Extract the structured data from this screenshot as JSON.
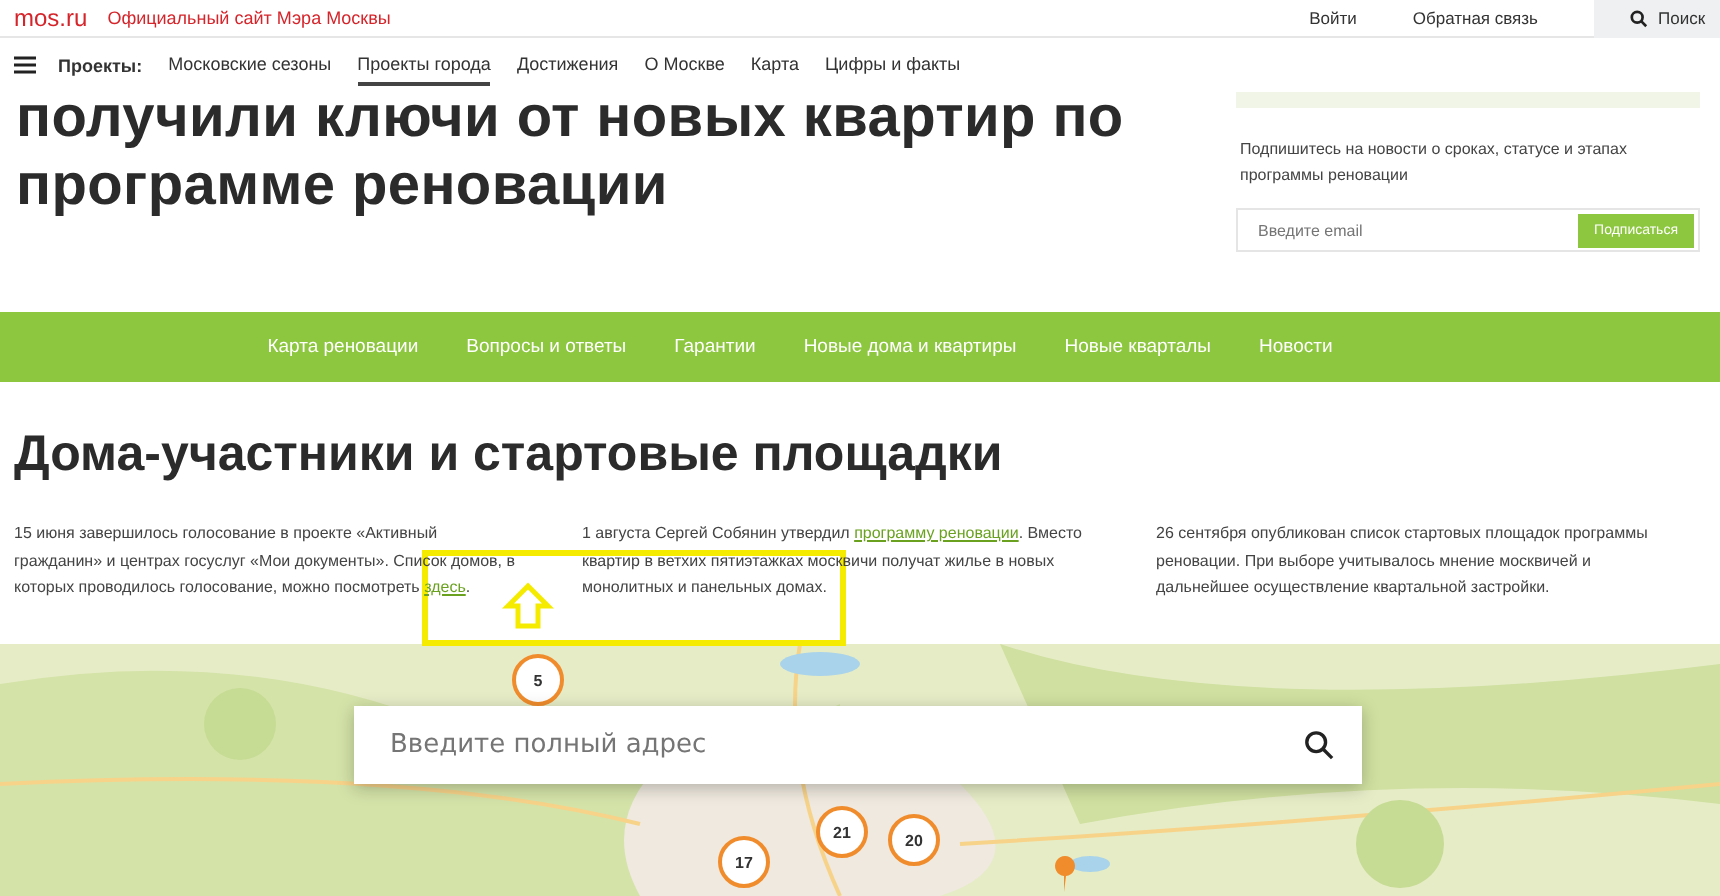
{
  "topbar": {
    "logo": "mos.ru",
    "site_title": "Официальный сайт Мэра Москвы",
    "links": [
      "Войти",
      "Обратная связь"
    ],
    "search": "Поиск"
  },
  "nav": {
    "label": "Проекты:",
    "items": [
      {
        "label": "Московские сезоны",
        "selected": false
      },
      {
        "label": "Проекты города",
        "selected": true
      },
      {
        "label": "Достижения",
        "selected": false
      },
      {
        "label": "О Москве",
        "selected": false
      },
      {
        "label": "Карта",
        "selected": false
      },
      {
        "label": "Цифры и факты",
        "selected": false
      }
    ]
  },
  "hero": {
    "title": "получили ключи от новых квартир по программе реновации"
  },
  "subscribe": {
    "text": "Подпишитесь на новости о сроках, статусе и этапах программы реновации",
    "placeholder": "Введите email",
    "button": "Подписаться"
  },
  "section_nav": [
    "Карта реновации",
    "Вопросы и ответы",
    "Гарантии",
    "Новые дома и квартиры",
    "Новые кварталы",
    "Новости"
  ],
  "section": {
    "title": "Дома-участники и стартовые площадки",
    "columns": [
      {
        "text": "15 июня завершилось голосование в проекте «Активный гражданин» и центрах госуслуг «Мои документы». Список домов, в которых проводилось голосование, можно посмотреть ",
        "link": "здесь",
        "after": "."
      },
      {
        "text": "1 августа Сергей Собянин утвердил ",
        "link": "программу реновации",
        "after": ". Вместо квартир в ветхих пятиэтажках москвичи получат жилье в новых монолитных и панельных домах."
      },
      {
        "text": "26 сентября опубликован список стартовых площадок программы реновации. При выборе учитывалось мнение москвичей и дальнейшее осуществление квартальной застройки."
      }
    ]
  },
  "map": {
    "kind": "picture",
    "search_placeholder": "Введите полный адрес",
    "clusters": [
      "5",
      "21",
      "20",
      "17"
    ]
  }
}
